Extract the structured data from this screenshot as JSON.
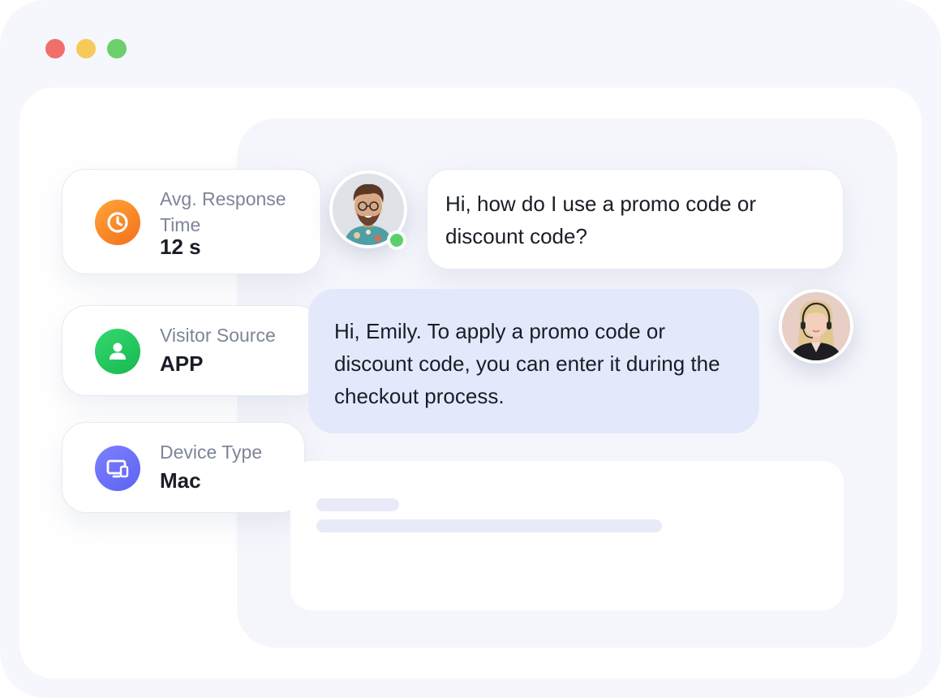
{
  "window": {
    "controls": [
      "close",
      "minimize",
      "maximize"
    ],
    "colors": {
      "close": "#f06f6a",
      "minimize": "#f6c95a",
      "maximize": "#6bd069"
    }
  },
  "stats": {
    "response_time": {
      "label": "Avg. Response Time",
      "value": "12 s",
      "icon": "clock-icon",
      "color": "#f68a2a"
    },
    "visitor_source": {
      "label": "Visitor Source",
      "value": "APP",
      "icon": "user-icon",
      "color": "#22c55e"
    },
    "device_type": {
      "label": "Device Type",
      "value": "Mac",
      "icon": "devices-icon",
      "color": "#6a6ff8"
    }
  },
  "chat": {
    "visitor": {
      "avatar": "visitor-avatar",
      "status": "online",
      "message": "Hi, how do I use a promo code or discount code?"
    },
    "agent": {
      "avatar": "agent-avatar",
      "message": "Hi, Emily. To apply a promo code or discount code, you can enter it during the checkout process."
    }
  },
  "colors": {
    "agent_bubble": "#e3e9fb",
    "online": "#5bd06a"
  }
}
